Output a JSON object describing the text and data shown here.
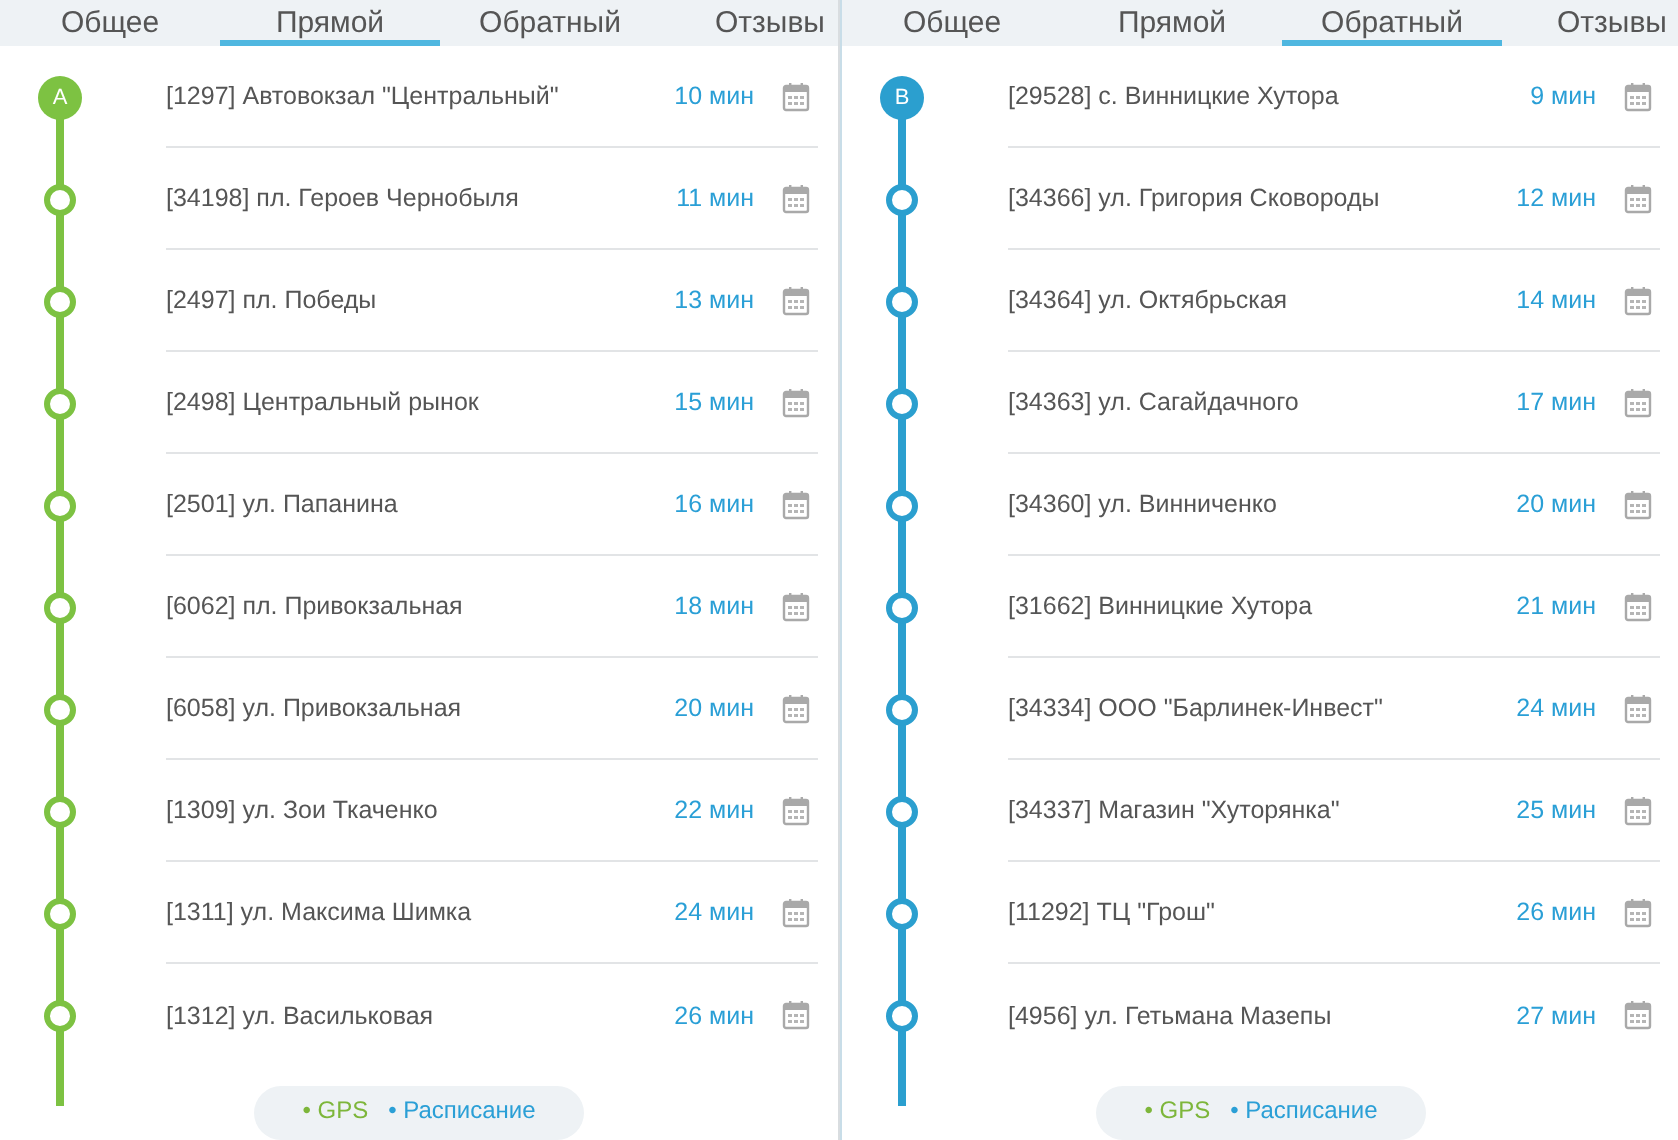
{
  "panels": [
    {
      "tabs": [
        {
          "label": "Общее",
          "selected": false
        },
        {
          "label": "Прямой",
          "selected": true
        },
        {
          "label": "Обратный",
          "selected": false
        },
        {
          "label": "Отзывы",
          "selected": false
        }
      ],
      "color": "#7dc242",
      "marker": "A",
      "stops": [
        {
          "name": "[1297] Автовокзал \"Центральный\"",
          "time": "10 мин"
        },
        {
          "name": "[34198] пл. Героев Чернобыля",
          "time": "11 мин"
        },
        {
          "name": "[2497] пл. Победы",
          "time": "13 мин"
        },
        {
          "name": "[2498] Центральный рынок",
          "time": "15 мин"
        },
        {
          "name": "[2501] ул. Папанина",
          "time": "16 мин"
        },
        {
          "name": "[6062] пл. Привокзальная",
          "time": "18 мин"
        },
        {
          "name": "[6058] ул. Привокзальная",
          "time": "20 мин"
        },
        {
          "name": "[1309] ул. Зои Ткаченко",
          "time": "22 мин"
        },
        {
          "name": "[1311] ул. Максима Шимка",
          "time": "24 мин"
        },
        {
          "name": "[1312] ул. Васильковая",
          "time": "26 мин"
        }
      ],
      "legend": [
        {
          "label": "• GPS",
          "color": "#7db63a"
        },
        {
          "label": "• Расписание",
          "color": "#2a9fd6"
        }
      ]
    },
    {
      "tabs": [
        {
          "label": "Общее",
          "selected": false
        },
        {
          "label": "Прямой",
          "selected": false
        },
        {
          "label": "Обратный",
          "selected": true
        },
        {
          "label": "Отзывы",
          "selected": false
        }
      ],
      "color": "#2b9fcf",
      "marker": "B",
      "stops": [
        {
          "name": "[29528] с. Винницкие Хутора",
          "time": "9 мин"
        },
        {
          "name": "[34366] ул. Григория Сковороды",
          "time": "12 мин"
        },
        {
          "name": "[34364] ул. Октябрьская",
          "time": "14 мин"
        },
        {
          "name": "[34363] ул. Сагайдачного",
          "time": "17 мин"
        },
        {
          "name": "[34360] ул. Винниченко",
          "time": "20 мин"
        },
        {
          "name": "[31662] Винницкие Хутора",
          "time": "21 мин"
        },
        {
          "name": "[34334] ООО \"Барлинек-Инвест\"",
          "time": "24 мин"
        },
        {
          "name": "[34337] Магазин \"Хуторянка\"",
          "time": "25 мин"
        },
        {
          "name": "[11292] ТЦ \"Грош\"",
          "time": "26 мин"
        },
        {
          "name": "[4956] ул. Гетьмана Мазепы",
          "time": "27 мин"
        }
      ],
      "legend": [
        {
          "label": "• GPS",
          "color": "#7db63a"
        },
        {
          "label": "• Расписание",
          "color": "#2a9fd6"
        }
      ]
    }
  ]
}
